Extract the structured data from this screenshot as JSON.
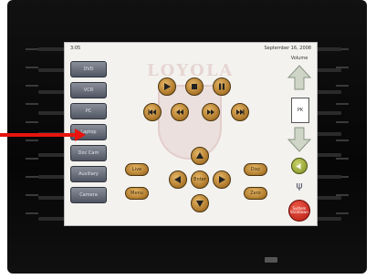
{
  "header": {
    "time": "3:05",
    "date": "September 16, 2008"
  },
  "watermark": {
    "text": "LOYOLA"
  },
  "menu": {
    "items": [
      "DVD",
      "VCR",
      "PC",
      "Laptop",
      "Doc Cam",
      "Auxiliary",
      "Camera"
    ]
  },
  "transport": {
    "play": "play-icon",
    "stop": "stop-icon",
    "pause": "pause-icon",
    "skip_back": "skip-back-icon",
    "rewind": "rewind-icon",
    "fast_forward": "fast-forward-icon",
    "skip_forward": "skip-forward-icon"
  },
  "nav": {
    "menu_label": "Enter",
    "left_top": "Live",
    "left_bottom": "Menu",
    "right_top": "Disc",
    "right_bottom": "Zero"
  },
  "volume": {
    "label": "Volume",
    "value": "PK",
    "mute_label": "Mute"
  },
  "shutdown": {
    "label": "System Shutdown"
  },
  "colors": {
    "accent": "#b07a2c",
    "warning": "#e8140e",
    "mute": "#7f8c1e"
  }
}
